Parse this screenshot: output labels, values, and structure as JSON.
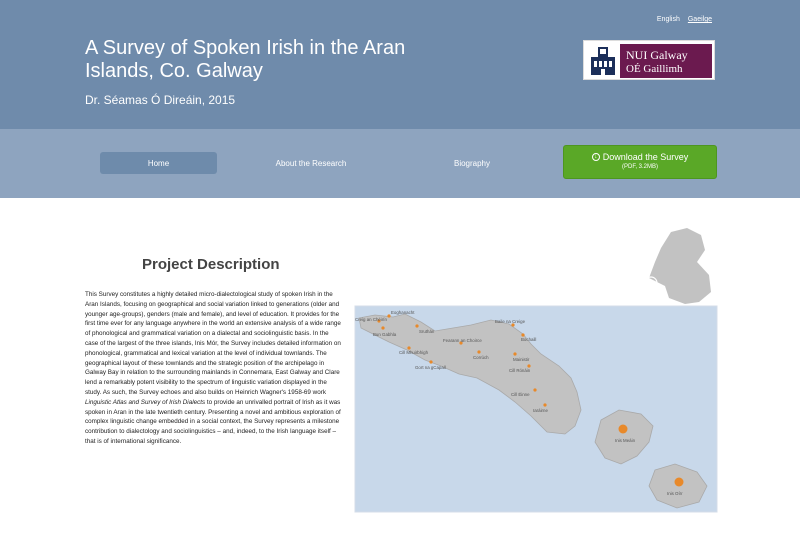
{
  "header": {
    "languages": [
      "English",
      "Gaeilge"
    ],
    "title": "A Survey of Spoken Irish in the Aran Islands, Co. Galway",
    "author_line": "Dr. Séamas Ó Direáin, 2015",
    "logo": {
      "line1": "NUI Galway",
      "line2": "OÉ Gaillimh"
    }
  },
  "nav": {
    "items": [
      "Home",
      "About the Research",
      "Biography"
    ],
    "active": "Home",
    "download": {
      "label": "Download the Survey",
      "sub": "(PDF, 3.2MB)",
      "icon": "download-circle-icon"
    }
  },
  "main": {
    "heading": "Project Description",
    "paragraph_parts": [
      "This Survey constitutes a highly detailed micro-dialectological study of spoken Irish in the Aran Islands, focusing on geographical and social variation linked to generations (older and younger age-groups), genders (male and female), and level of education. It provides for the first time ever for any language anywhere in the world an extensive analysis of a wide range of phonological and grammatical variation on a dialectal and sociolinguistic basis. In the case of the largest of the three islands, Inis Mór, the Survey includes detailed information on phonological, grammatical and lexical variation at the level of individual townlands. The geographical layout of these townlands and the strategic position of the archipelago in Galway Bay in relation to the surrounding mainlands in Connemara, East Galway and Clare lend a remarkably potent visibility to the spectrum of linguistic variation displayed in the study. As such, the Survey echoes and also builds on Heinrich Wagner's 1958-69 work ",
      "Linguistic Atlas and Survey of Irish Dialects",
      " to provide an unrivalled portrait of Irish as it was spoken in Aran in the late twentieth century. Presenting a novel and ambitious exploration of complex linguistic change embedded in a social context, the Survey represents a milestone contribution to dialectology and sociolinguistics – and, indeed, to the Irish language itself – that is of international significance."
    ]
  },
  "map": {
    "colors": {
      "sea": "#c8d8ea",
      "land": "#c2c2c2",
      "land_edge": "#a9a9a9",
      "marker": "#e8892a"
    },
    "labels": [
      "Creig an Chéirín",
      "Eoghanacht",
      "Bun Gabhla",
      "Sruthán",
      "Baile na Creige",
      "Bochaill",
      "Fearann an Choirce",
      "Cill Mhuirbhigh",
      "Corrúch",
      "Mainistir",
      "Gort na gCapall",
      "Cill Rónáin",
      "Cill Éinne",
      "Iaráirne",
      "Inis Meáin",
      "Inis Oírr"
    ]
  }
}
